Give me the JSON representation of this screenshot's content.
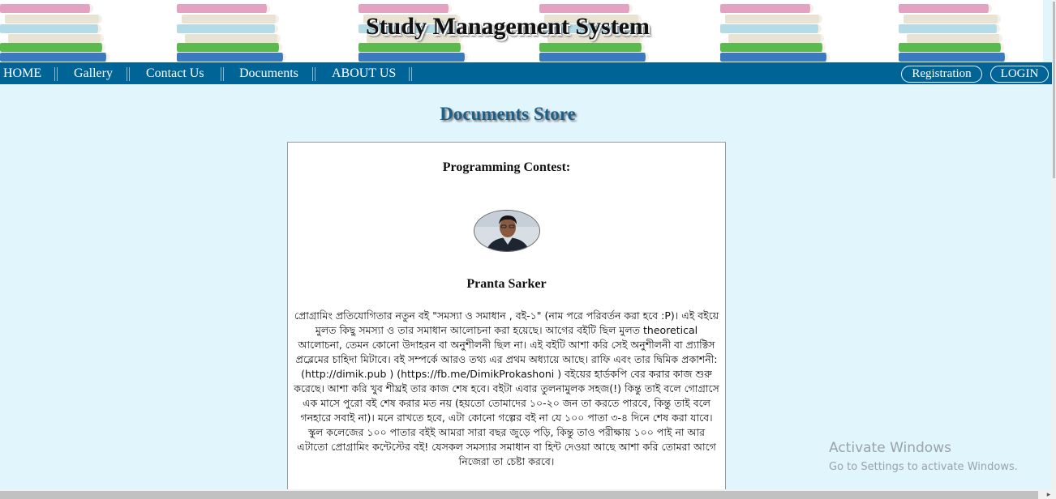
{
  "header": {
    "site_title": "Study Management System",
    "banner_icon": "book-stack-icon"
  },
  "nav": {
    "items": [
      {
        "label": "HOME"
      },
      {
        "label": "Gallery"
      },
      {
        "label": "Contact Us"
      },
      {
        "label": "Documents"
      },
      {
        "label": "ABOUT US"
      }
    ],
    "registration_label": "Registration",
    "login_label": "LOGIN"
  },
  "main": {
    "heading": "Documents Store",
    "card": {
      "title": "Programming Contest:",
      "author_name": "Pranta Sarker",
      "body": "প্রোগ্রামিং প্রতিযোগিতার নতুন বই \"সমস্যা ও সমাধান , বই-১\" (নাম পরে পরিবর্তন করা হবে :P)। এই বইয়ে মুলত কিছু সমস্যা ও তার সমাধান আলোচনা করা হয়েছে। আগের বইটি ছিল মুলত theoretical আলোচনা, তেমন কোনো উদাহরন বা অনুশীলনী ছিল না। এই বইটি আশা করি সেই অনুশীলনী বা প্র্যাক্টিস প্রব্লেমের চাহিদা মিটাবে। বই সম্পর্কে আরও তথ্য এর প্রথম অধ্যায়ে আছে। রাফি এবং তার দ্বিমিক প্রকাশনী: (http://dimik.pub ) (https://fb.me/DimikProkashoni ) বইয়ের হার্ডকপি বের করার কাজ শুরু করেছে। আশা করি খুব শীঘ্রই তার কাজ শেষ হবে। বইটা এবার তুলনামুলক সহজ(!) কিন্তু তাই বলে গোগ্রাসে এক মাসে পুরো বই শেষ করার মত নয় (হয়তো তোমাদের ১০-২০ জন তা করতে পারবে, কিন্তু তাই বলে গনহারে সবাই না)। মনে রাখতে হবে, এটা কোনো গল্পের বই না যে ১০০ পাতা ৩-৪ দিনে শেষ করা যাবে। স্কুল কলেজের ১০০ পাতার বইই আমরা সারা বছর জুড়ে পড়ি, কিন্তু তাও পরীক্ষায় ১০০ পাই না আর এটাতো প্রোগ্রামিং কন্টেস্টের বই! যেসকল সমস্যার সমাধান বা হিন্ট দেওয়া আছে আশা করি তোমরা আগে নিজেরা তা চেষ্টা করবে।"
    }
  },
  "watermark": {
    "title": "Activate Windows",
    "subtitle": "Go to Settings to activate Windows."
  }
}
